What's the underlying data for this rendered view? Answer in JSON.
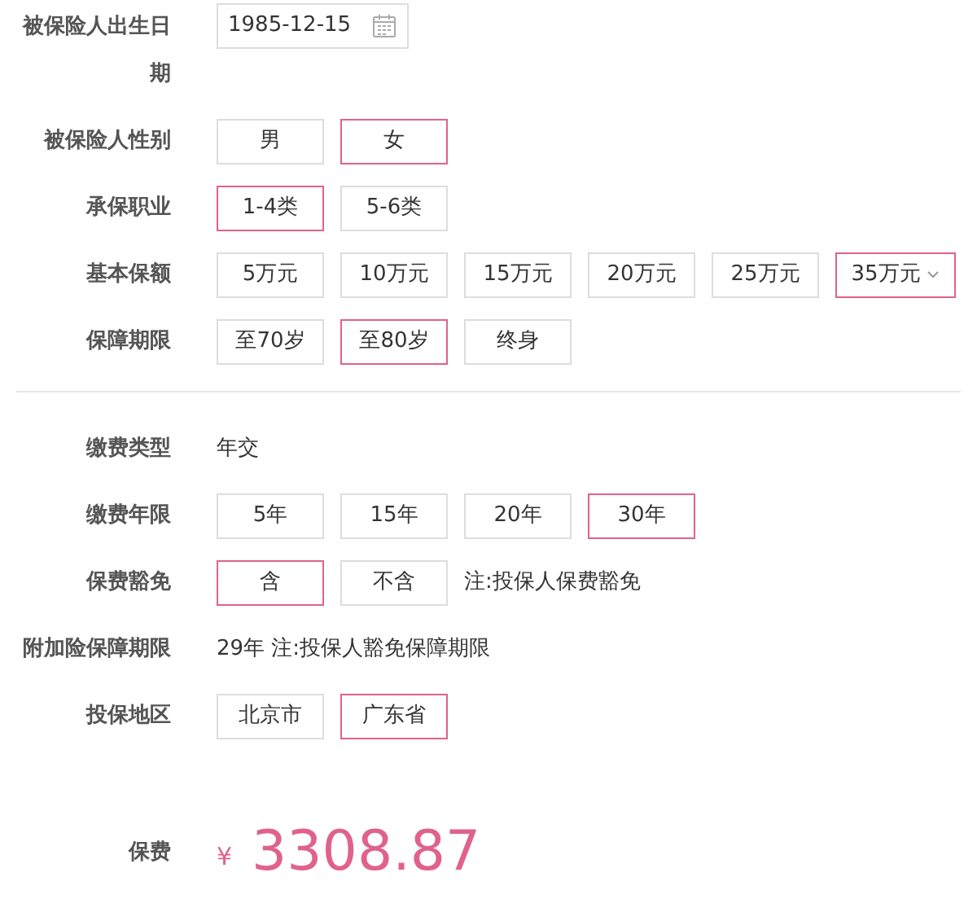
{
  "sections": [
    {
      "rows": [
        {
          "kind": "date",
          "label": "被保险人出生日期",
          "value": "1985-12-15"
        },
        {
          "kind": "options",
          "label": "被保险人性别",
          "options": [
            {
              "kind": "option",
              "text": "男",
              "selected": false
            },
            {
              "kind": "option",
              "text": "女",
              "selected": true
            }
          ]
        },
        {
          "kind": "options",
          "label": "承保职业",
          "options": [
            {
              "kind": "option",
              "text": "1-4类",
              "selected": true
            },
            {
              "kind": "option",
              "text": "5-6类",
              "selected": false
            }
          ]
        },
        {
          "kind": "options",
          "label": "基本保额",
          "options": [
            {
              "kind": "option",
              "text": "5万元",
              "selected": false
            },
            {
              "kind": "option",
              "text": "10万元",
              "selected": false
            },
            {
              "kind": "option",
              "text": "15万元",
              "selected": false
            },
            {
              "kind": "option",
              "text": "20万元",
              "selected": false
            },
            {
              "kind": "option",
              "text": "25万元",
              "selected": false
            },
            {
              "kind": "dropdown",
              "text": "35万元",
              "selected": true
            }
          ]
        },
        {
          "kind": "options",
          "label": "保障期限",
          "options": [
            {
              "kind": "option",
              "text": "至70岁",
              "selected": false
            },
            {
              "kind": "option",
              "text": "至80岁",
              "selected": true
            },
            {
              "kind": "option",
              "text": "终身",
              "selected": false
            }
          ]
        }
      ]
    },
    {
      "rows": [
        {
          "kind": "text",
          "label": "缴费类型",
          "value": "年交"
        },
        {
          "kind": "options",
          "label": "缴费年限",
          "options": [
            {
              "kind": "option",
              "text": "5年",
              "selected": false
            },
            {
              "kind": "option",
              "text": "15年",
              "selected": false
            },
            {
              "kind": "option",
              "text": "20年",
              "selected": false
            },
            {
              "kind": "option",
              "text": "30年",
              "selected": true
            }
          ]
        },
        {
          "kind": "options",
          "label": "保费豁免",
          "options": [
            {
              "kind": "option",
              "text": "含",
              "selected": true
            },
            {
              "kind": "option",
              "text": "不含",
              "selected": false
            }
          ],
          "note": "注:投保人保费豁免"
        },
        {
          "kind": "text",
          "label": "附加险保障期限",
          "value": "29年 注:投保人豁免保障期限"
        },
        {
          "kind": "options",
          "label": "投保地区",
          "options": [
            {
              "kind": "option",
              "text": "北京市",
              "selected": false
            },
            {
              "kind": "option",
              "text": "广东省",
              "selected": true
            }
          ]
        },
        {
          "kind": "price",
          "label": "保费",
          "currency": "¥",
          "value": "3308.87"
        }
      ]
    }
  ]
}
